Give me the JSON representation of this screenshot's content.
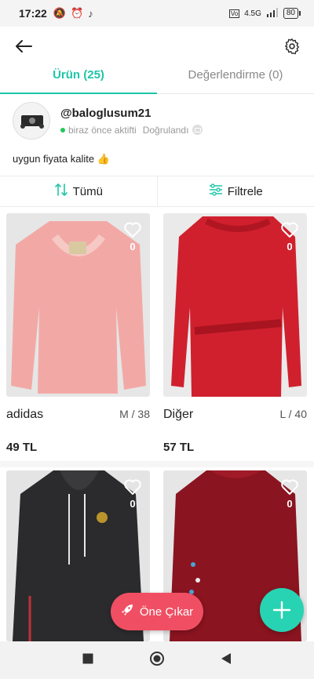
{
  "status_bar": {
    "time": "17:22",
    "network": "4.5G",
    "battery": "80"
  },
  "tabs": [
    {
      "label": "Ürün (25)",
      "active": true
    },
    {
      "label": "Değerlendirme (0)",
      "active": false
    }
  ],
  "profile": {
    "username": "@baloglusum21",
    "activity": "biraz önce aktifti",
    "verified": "Doğrulandı",
    "bio": "uygun fiyata kalite 👍"
  },
  "filters": {
    "sort_label": "Tümü",
    "filter_label": "Filtrele"
  },
  "products": [
    {
      "brand": "adidas",
      "size": "M / 38",
      "price": "49 TL",
      "likes": "0",
      "color": "#f2a9a6"
    },
    {
      "brand": "Diğer",
      "size": "L / 40",
      "price": "57 TL",
      "likes": "0",
      "color": "#d0202e"
    },
    {
      "brand": "",
      "size": "",
      "price": "",
      "likes": "0",
      "color": "#2b2b2d"
    },
    {
      "brand": "",
      "size": "",
      "price": "",
      "likes": "0",
      "color": "#8a1420"
    }
  ],
  "promote_button": {
    "label": "Öne Çıkar"
  },
  "colors": {
    "accent": "#1ec6a8",
    "fab": "#27d3b2",
    "promote": "#f04f63",
    "online": "#21c95a"
  }
}
